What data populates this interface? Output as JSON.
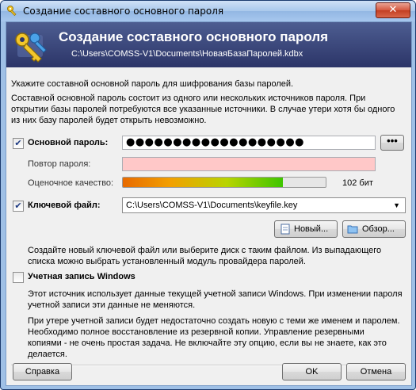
{
  "window": {
    "title": "Создание составного основного пароля",
    "close_label": "✕"
  },
  "banner": {
    "title": "Создание составного основного пароля",
    "subtitle": "C:\\Users\\COMSS-V1\\Documents\\НоваяБазаПаролей.kdbx"
  },
  "intro": {
    "line1": "Укажите составной основной пароль для шифрования базы паролей.",
    "para_lines": [
      "Составной основной пароль состоит из одного или нескольких источников пароля. При",
      "открытии базы паролей потребуются все указанные источники. В случае утери хотя бы одного",
      "из них базу паролей будет открыть невозможно."
    ]
  },
  "master_password": {
    "checkbox_label": "Основной пароль:",
    "checked": true,
    "value": "●●●●●●●●●●●●●●●●●●●",
    "toggle_label": "•••",
    "repeat_label": "Повтор пароля:",
    "repeat_value": "",
    "quality_label": "Оценочное качество:",
    "quality_percent": 0.79,
    "quality_text": "102 бит"
  },
  "key_file": {
    "checkbox_label": "Ключевой файл:",
    "checked": true,
    "selected": "C:\\Users\\COMSS-V1\\Documents\\keyfile.key",
    "new_button": "Новый...",
    "browse_button": "Обзор...",
    "hint_lines": [
      "Создайте новый ключевой файл или выберите диск с таким файлом. Из выпадающего",
      "списка можно выбрать установленный модуль провайдера паролей."
    ]
  },
  "windows_account": {
    "checkbox_label": "Учетная запись Windows",
    "checked": false,
    "desc1_lines": [
      "Этот источник использует данные текущей учетной записи Windows. При изменении пароля",
      "учетной записи эти данные не меняются."
    ],
    "desc2_lines": [
      "При утере учетной записи будет недостаточно создать новую с теми же именем и паролем.",
      "Необходимо полное восстановление из резервной копии. Управление резервными",
      "копиями - не очень простая задача. Не включайте эту опцию, если вы не знаете, как это",
      "делается."
    ]
  },
  "footer": {
    "help_button": "Справка",
    "ok_button": "OK",
    "cancel_button": "Отмена"
  },
  "colors": {
    "banner": "#2c3568",
    "repeat_field_bg": "#ffc8c8",
    "quality_start": "#e86a00",
    "quality_end": "#3ec500"
  }
}
